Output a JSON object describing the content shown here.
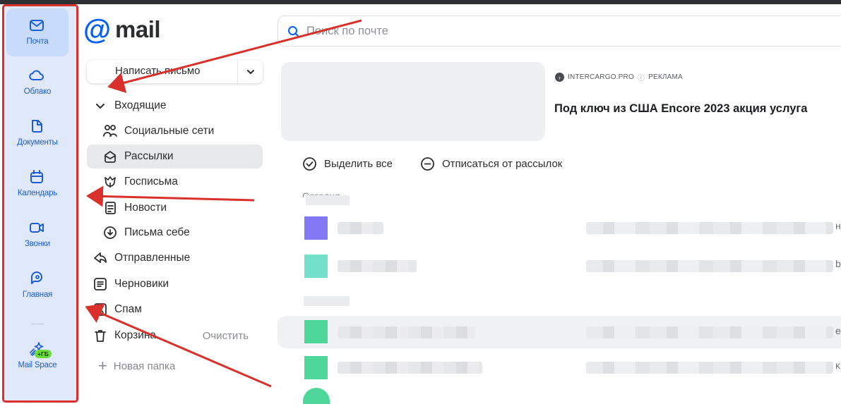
{
  "rail": {
    "items": [
      {
        "label": "Почта",
        "icon": "mail-icon"
      },
      {
        "label": "Облако",
        "icon": "cloud-icon"
      },
      {
        "label": "Документы",
        "icon": "document-icon"
      },
      {
        "label": "Календарь",
        "icon": "calendar-icon"
      },
      {
        "label": "Звонки",
        "icon": "video-call-icon"
      },
      {
        "label": "Главная",
        "icon": "home-chat-icon"
      },
      {
        "label": "Mail Space",
        "icon": "sparkle-icon",
        "badge": "+ГБ"
      }
    ]
  },
  "logo": {
    "at": "@",
    "word": "mail"
  },
  "compose": {
    "label": "Написать письмо"
  },
  "folders": {
    "inbox": "Входящие",
    "social": "Социальные сети",
    "newsletters": "Рассылки",
    "gov": "Госписьма",
    "news": "Новости",
    "self": "Письма себе",
    "sent": "Отправленные",
    "drafts": "Черновики",
    "spam": "Спам",
    "trash": "Корзина",
    "trash_clear": "Очистить",
    "new_folder": "Новая папка"
  },
  "search": {
    "placeholder": "Поиск по почте"
  },
  "ad": {
    "source": "INTERCARGO.PRO",
    "tag": "РЕКЛАМА",
    "title": "Под ключ из США Encore 2023 акция услуга"
  },
  "toolbar": {
    "select_all": "Выделить все",
    "unsubscribe": "Отписаться от рассылок"
  },
  "list": {
    "day_label": "Сегодня",
    "rows": [
      {
        "avatar_color": "#8378f4",
        "edge": "н"
      },
      {
        "avatar_color": "#72e0c8",
        "edge": "b"
      },
      {
        "avatar_color": "#4fd79b",
        "edge": "e"
      },
      {
        "avatar_color": "#4fd79b",
        "edge": "ĸ"
      }
    ]
  },
  "colors": {
    "accent": "#005ff9",
    "rail_bg": "#dfe9fb",
    "annotation": "#d9302c"
  }
}
